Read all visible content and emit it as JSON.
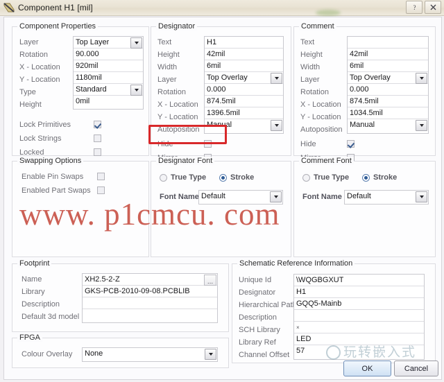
{
  "window": {
    "title": "Component H1 [mil]",
    "icon": "component-icon",
    "help_label": "?",
    "close_label": "✕"
  },
  "component_properties": {
    "legend": "Component Properties",
    "fields": [
      {
        "label": "Layer",
        "value": "Top Layer",
        "type": "dropdown"
      },
      {
        "label": "Rotation",
        "value": "90.000",
        "type": "text"
      },
      {
        "label": "X - Location",
        "value": "920mil",
        "type": "text"
      },
      {
        "label": "Y - Location",
        "value": "1180mil",
        "type": "text"
      },
      {
        "label": "Type",
        "value": "Standard",
        "type": "dropdown"
      },
      {
        "label": "Height",
        "value": "0mil",
        "type": "text"
      }
    ],
    "checks": [
      {
        "label": "Lock Primitives",
        "checked": true
      },
      {
        "label": "Lock Strings",
        "checked": false
      },
      {
        "label": "Locked",
        "checked": false
      }
    ]
  },
  "designator": {
    "legend": "Designator",
    "fields": [
      {
        "label": "Text",
        "value": "H1",
        "type": "text"
      },
      {
        "label": "Height",
        "value": "42mil",
        "type": "text"
      },
      {
        "label": "Width",
        "value": "6mil",
        "type": "text"
      },
      {
        "label": "Layer",
        "value": "Top Overlay",
        "type": "dropdown"
      },
      {
        "label": "Rotation",
        "value": "0.000",
        "type": "text"
      },
      {
        "label": "X - Location",
        "value": "874.5mil",
        "type": "text"
      },
      {
        "label": "Y - Location",
        "value": "1396.5mil",
        "type": "text"
      },
      {
        "label": "Autoposition",
        "value": "Manual",
        "type": "dropdown"
      }
    ],
    "checks": [
      {
        "label": "Hide",
        "checked": false
      },
      {
        "label": "Mirror",
        "checked": false
      }
    ]
  },
  "comment": {
    "legend": "Comment",
    "fields": [
      {
        "label": "Text",
        "value": "",
        "type": "text"
      },
      {
        "label": "Height",
        "value": "42mil",
        "type": "text"
      },
      {
        "label": "Width",
        "value": "6mil",
        "type": "text"
      },
      {
        "label": "Layer",
        "value": "Top Overlay",
        "type": "dropdown"
      },
      {
        "label": "Rotation",
        "value": "0.000",
        "type": "text"
      },
      {
        "label": "X - Location",
        "value": "874.5mil",
        "type": "text"
      },
      {
        "label": "Y - Location",
        "value": "1034.5mil",
        "type": "text"
      },
      {
        "label": "Autoposition",
        "value": "Manual",
        "type": "dropdown"
      }
    ],
    "checks": [
      {
        "label": "Hide",
        "checked": true
      },
      {
        "label": "Mirror",
        "checked": false
      }
    ]
  },
  "swapping_options": {
    "legend": "Swapping Options",
    "checks": [
      {
        "label": "Enable Pin Swaps",
        "checked": false
      },
      {
        "label": "Enabled Part Swaps",
        "checked": false
      }
    ]
  },
  "designator_font": {
    "legend": "Designator Font",
    "radios": [
      {
        "label": "True Type",
        "selected": false
      },
      {
        "label": "Stroke",
        "selected": true
      }
    ],
    "font_name_label": "Font Name",
    "font_name_value": "Default"
  },
  "comment_font": {
    "legend": "Comment Font",
    "radios": [
      {
        "label": "True Type",
        "selected": false
      },
      {
        "label": "Stroke",
        "selected": true
      }
    ],
    "font_name_label": "Font Name",
    "font_name_value": "Default"
  },
  "footprint": {
    "legend": "Footprint",
    "browse_label": "...",
    "fields": [
      {
        "label": "Name",
        "value": "XH2.5-2-Z"
      },
      {
        "label": "Library",
        "value": "GKS-PCB-2010-09-08.PCBLIB"
      },
      {
        "label": "Description",
        "value": ""
      },
      {
        "label": "Default 3d model",
        "value": ""
      }
    ]
  },
  "fpga": {
    "legend": "FPGA",
    "colour_overlay_label": "Colour Overlay",
    "colour_overlay_value": "None"
  },
  "schematic_reference": {
    "legend": "Schematic Reference Information",
    "fields": [
      {
        "label": "Unique Id",
        "value": "\\WQGBGXUT"
      },
      {
        "label": "Designator",
        "value": "H1"
      },
      {
        "label": "Hierarchical Path",
        "value": "GQQ5-Mainb"
      },
      {
        "label": "Description",
        "value": ""
      },
      {
        "label": "SCH Library",
        "value": "×"
      },
      {
        "label": "Library Ref",
        "value": "LED"
      },
      {
        "label": "Channel Offset",
        "value": "57"
      }
    ]
  },
  "buttons": {
    "ok": "OK",
    "cancel": "Cancel"
  },
  "watermarks": {
    "main": "www. p1cmcu. com",
    "secondary": "玩转嵌入式"
  },
  "colors": {
    "highlight": "#d8282a",
    "watermark": "#c0392b"
  }
}
